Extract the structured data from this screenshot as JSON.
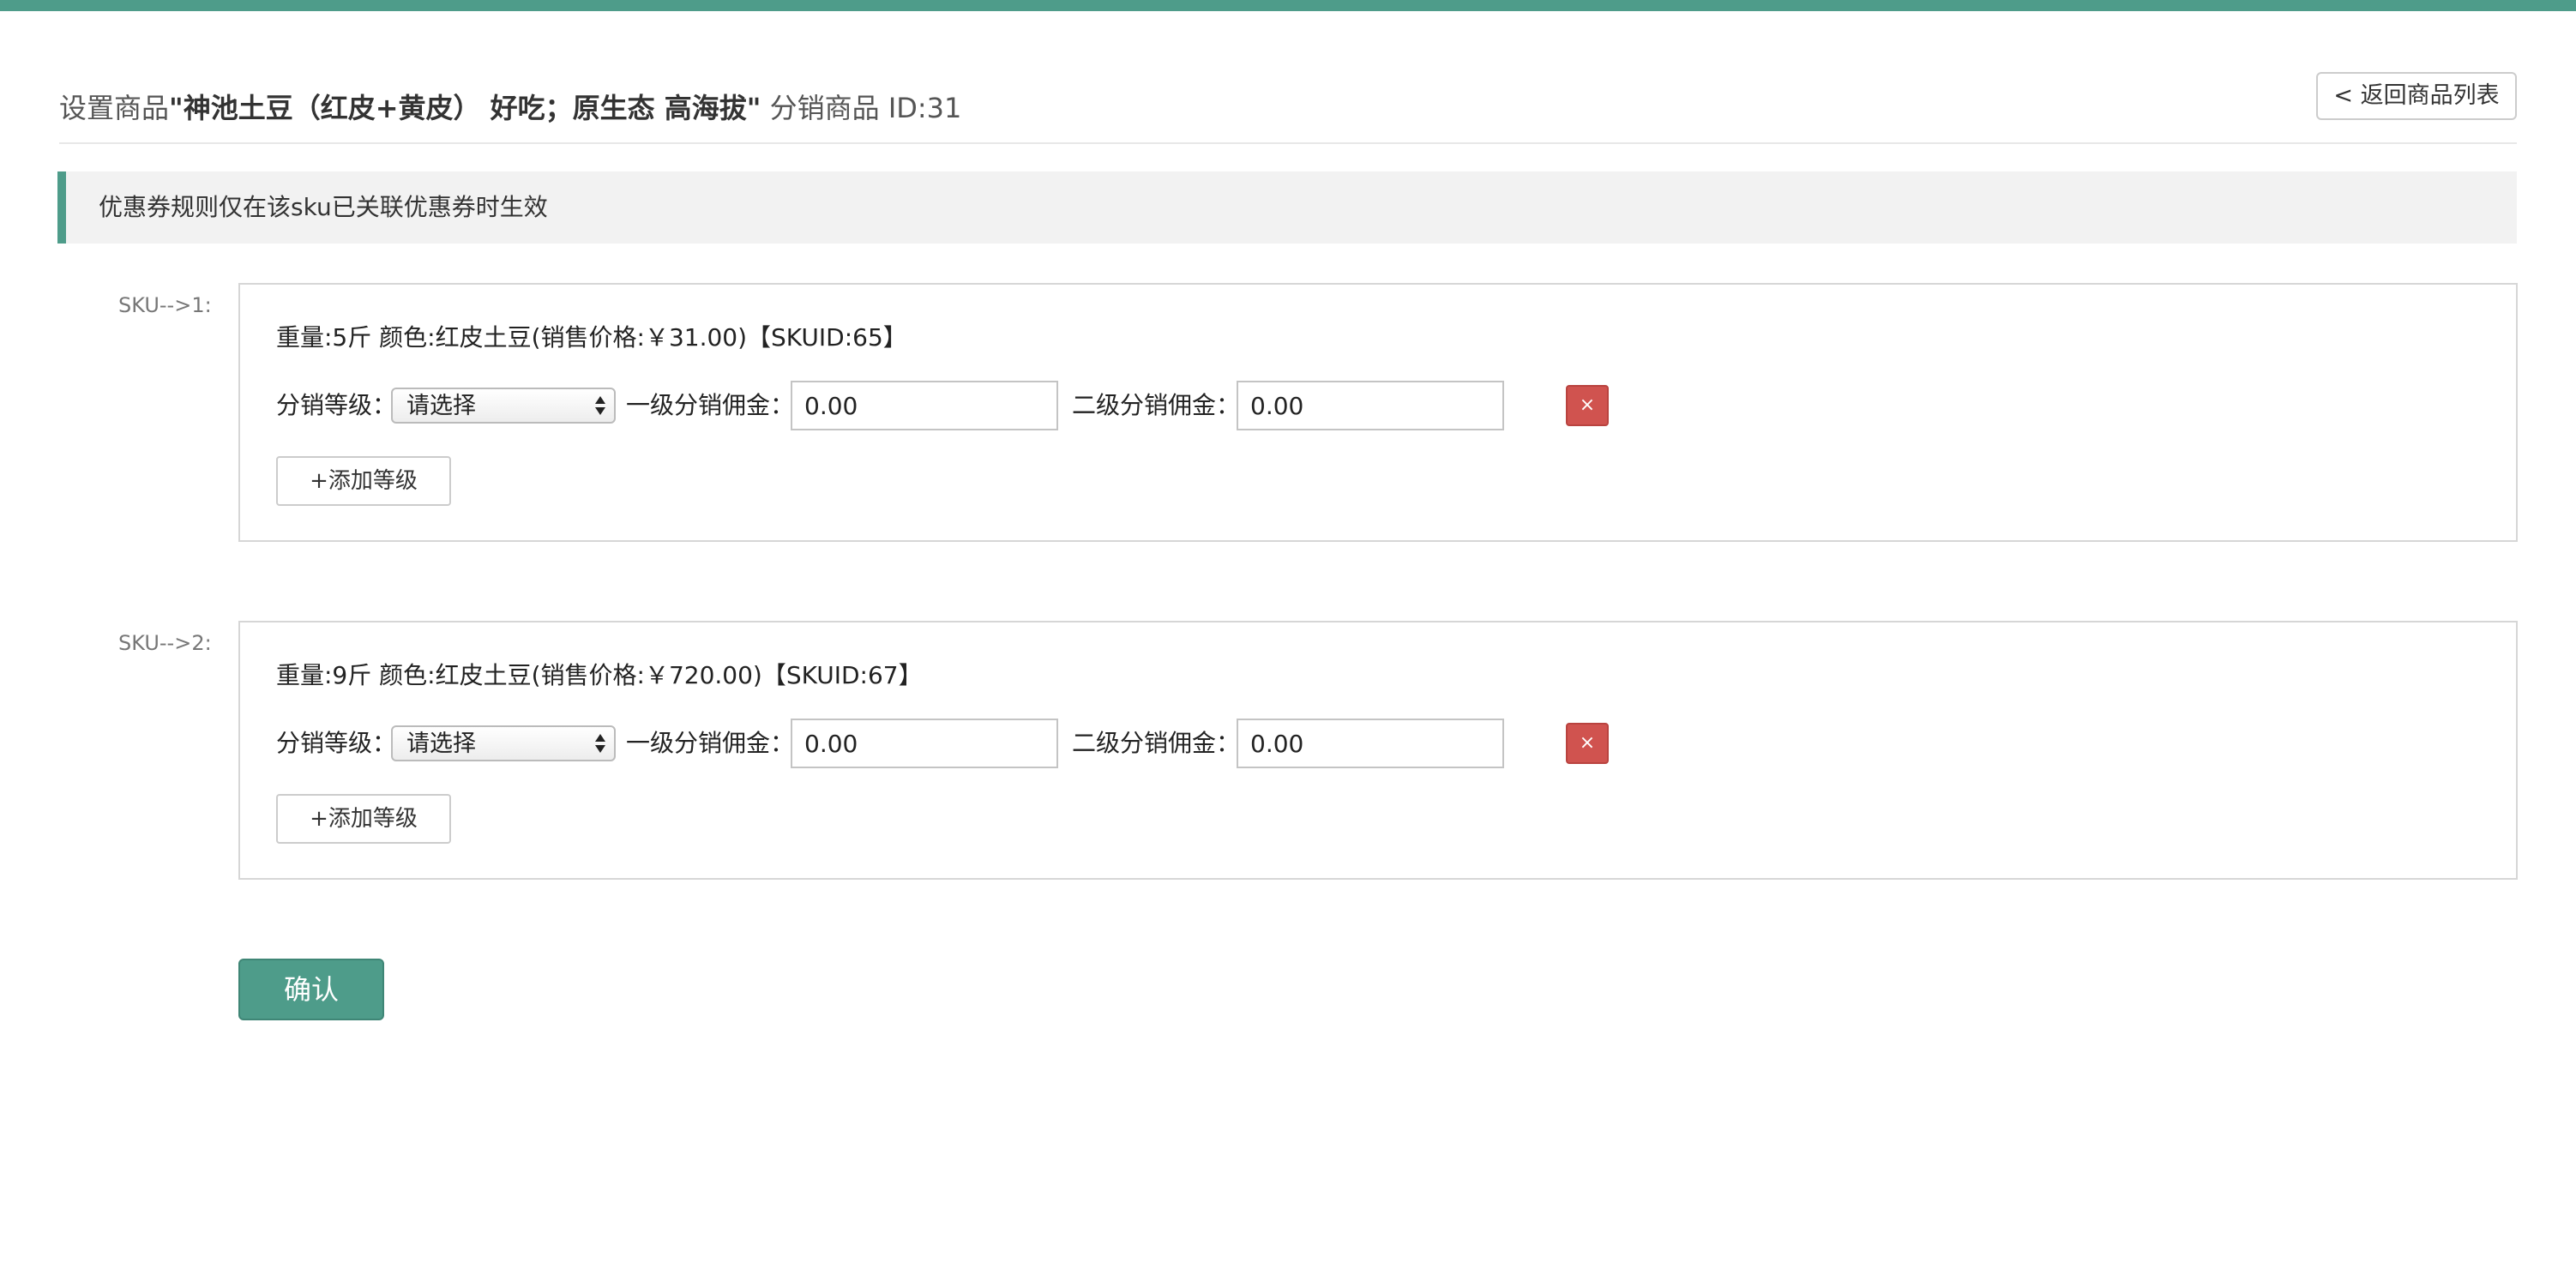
{
  "header": {
    "title_prefix": "设置商品",
    "product_name": "\"神池土豆（红皮+黄皮） 好吃；原生态 高海拔\"",
    "title_suffix": " 分销商品 ID:31",
    "back_label": "< 返回商品列表"
  },
  "notice": {
    "text": "优惠券规则仅在该sku已关联优惠券时生效"
  },
  "skus": [
    {
      "label": "SKU-->1:",
      "title": "重量:5斤 颜色:红皮土豆(销售价格:￥31.00)【SKUID:65】",
      "level_label": "分销等级：",
      "level_value": "请选择",
      "commission1_label": "一级分销佣金：",
      "commission1_value": "0.00",
      "commission2_label": "二级分销佣金：",
      "commission2_value": "0.00",
      "delete_label": "×",
      "add_level_label": "+添加等级"
    },
    {
      "label": "SKU-->2:",
      "title": "重量:9斤 颜色:红皮土豆(销售价格:￥720.00)【SKUID:67】",
      "level_label": "分销等级：",
      "level_value": "请选择",
      "commission1_label": "一级分销佣金：",
      "commission1_value": "0.00",
      "commission2_label": "二级分销佣金：",
      "commission2_value": "0.00",
      "delete_label": "×",
      "add_level_label": "+添加等级"
    }
  ],
  "footer": {
    "confirm_label": "确认"
  },
  "colors": {
    "accent": "#4e9c8a",
    "danger": "#d0534f",
    "notice_bg": "#f2f2f2"
  }
}
